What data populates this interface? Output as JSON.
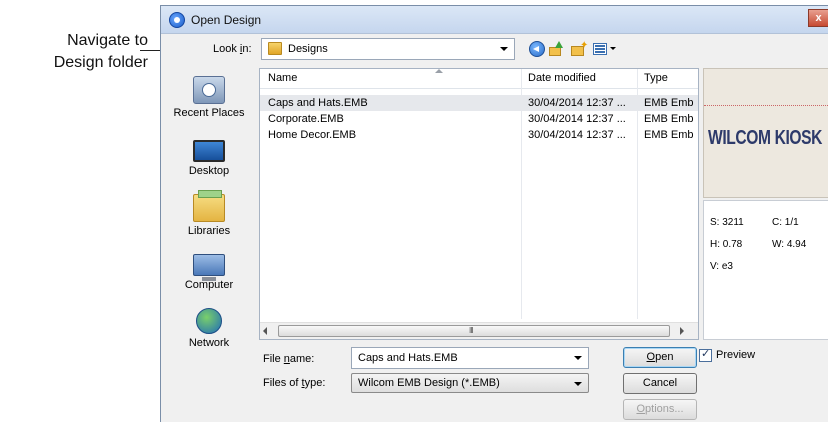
{
  "annotation": {
    "line1": "Navigate to",
    "line2": "Design folder"
  },
  "dialog": {
    "title": "Open Design",
    "close_label": "x",
    "look_in": {
      "label_pre": "Look ",
      "label_key": "i",
      "label_post": "n:",
      "value": "Designs"
    },
    "toolbar": {
      "icons": [
        "back-icon",
        "up-folder-icon",
        "new-folder-icon",
        "views-menu-icon"
      ]
    },
    "places": [
      {
        "label": "Recent Places",
        "icon": "recent-places-icon"
      },
      {
        "label": "Desktop",
        "icon": "desktop-icon"
      },
      {
        "label": "Libraries",
        "icon": "libraries-icon"
      },
      {
        "label": "Computer",
        "icon": "computer-icon"
      },
      {
        "label": "Network",
        "icon": "network-icon"
      }
    ],
    "columns": [
      "Name",
      "Date modified",
      "Type"
    ],
    "files": [
      {
        "name": "Caps and Hats.EMB",
        "date": "30/04/2014 12:37 ...",
        "type": "EMB Emb"
      },
      {
        "name": "Corporate.EMB",
        "date": "30/04/2014 12:37 ...",
        "type": "EMB Emb"
      },
      {
        "name": "Home Decor.EMB",
        "date": "30/04/2014 12:37 ...",
        "type": "EMB Emb"
      }
    ],
    "scroll_grip": "III",
    "preview": {
      "text": "WILCOM KIOSK",
      "stats": {
        "s": "S: 3211",
        "c": "C: 1/1",
        "h": "H: 0.78",
        "w": "W: 4.94",
        "v": "V: e3"
      },
      "checkbox_label": "Preview",
      "checked": true
    },
    "file_name": {
      "label_pre": "File ",
      "label_key": "n",
      "label_post": "ame:",
      "value": "Caps and Hats.EMB"
    },
    "file_type": {
      "label_pre": "Files of ",
      "label_key": "t",
      "label_post": "ype:",
      "value": "Wilcom EMB Design (*.EMB)"
    },
    "buttons": {
      "open": {
        "key": "O",
        "rest": "pen"
      },
      "cancel": "Cancel",
      "options": {
        "key": "O",
        "rest": "ptions..."
      }
    },
    "colors": {
      "title_bar": "#c5d6ee",
      "selected_row": "#e6e8ec",
      "close_button": "#c74a32",
      "preview_text": "#2d3a6a"
    }
  }
}
